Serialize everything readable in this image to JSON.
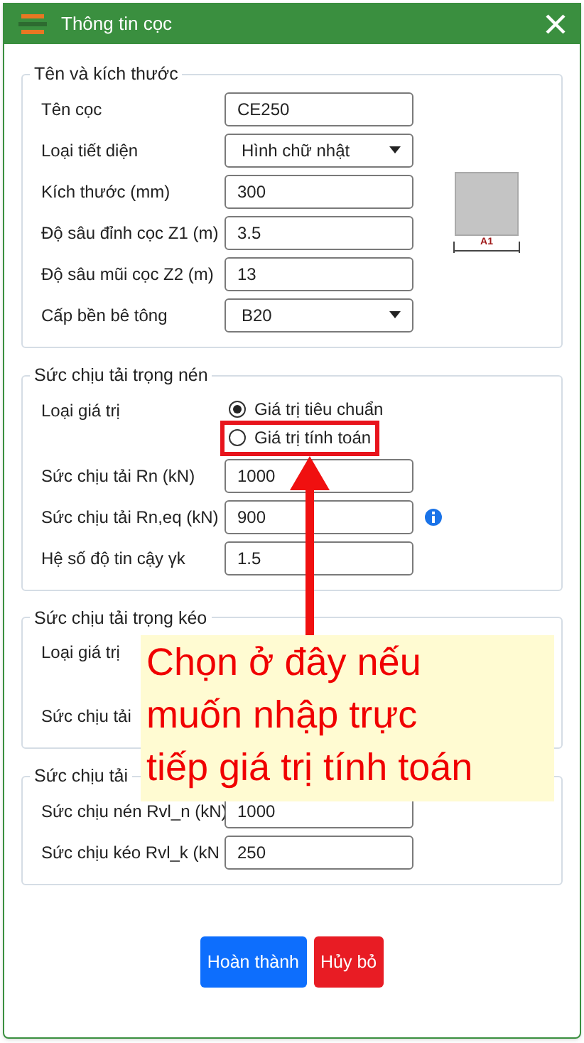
{
  "window": {
    "title": "Thông tin cọc"
  },
  "groups": [
    {
      "title": "Tên và kích thước",
      "preview_label": "A1",
      "fields": [
        {
          "kind": "text",
          "label": "Tên cọc",
          "value": "CE250"
        },
        {
          "kind": "select",
          "label": "Loại tiết diện",
          "value": "Hình chữ nhật"
        },
        {
          "kind": "text",
          "label": "Kích thước (mm)",
          "value": "300"
        },
        {
          "kind": "text",
          "label": "Độ sâu đỉnh cọc Z1 (m)",
          "value": "3.5"
        },
        {
          "kind": "text",
          "label": "Độ sâu mũi cọc Z2 (m)",
          "value": "13"
        },
        {
          "kind": "select",
          "label": "Cấp bền bê tông",
          "value": "B20"
        }
      ]
    },
    {
      "title": "Sức chịu tải trọng nén",
      "fields": [
        {
          "kind": "radio",
          "label": "Loại giá trị",
          "disabled": false,
          "options": [
            {
              "label": "Giá trị tiêu chuẩn",
              "selected": true,
              "highlighted": false
            },
            {
              "label": "Giá trị tính toán",
              "selected": false,
              "highlighted": true
            }
          ]
        },
        {
          "kind": "text",
          "label": "Sức chịu tải Rn (kN)",
          "value": "1000"
        },
        {
          "kind": "text",
          "label": "Sức chịu tải Rn,eq (kN)",
          "value": "900",
          "info": true
        },
        {
          "kind": "text",
          "label": "Hệ số độ tin cậy γk",
          "value": "1.5"
        }
      ]
    },
    {
      "title": "Sức chịu tải trọng kéo",
      "fields": [
        {
          "kind": "radio",
          "label": "Loại giá trị"
        },
        {
          "kind": "text",
          "label": "Sức chịu tải"
        }
      ]
    },
    {
      "title": "Sức chịu tải",
      "fields": [
        {
          "kind": "text",
          "label": "Sức chịu nén Rvl_n (kN)",
          "value": "1000"
        },
        {
          "kind": "text",
          "label": "Sức chịu kéo Rvl_k (kN",
          "value": "250"
        }
      ]
    }
  ],
  "buttons": [
    {
      "kind": "primary",
      "label": "Hoàn thành"
    },
    {
      "kind": "danger",
      "label": "Hủy bỏ"
    }
  ],
  "callout": {
    "text": "Chọn ở đây nếu muốn nhập trực tiếp giá trị tính toán"
  }
}
